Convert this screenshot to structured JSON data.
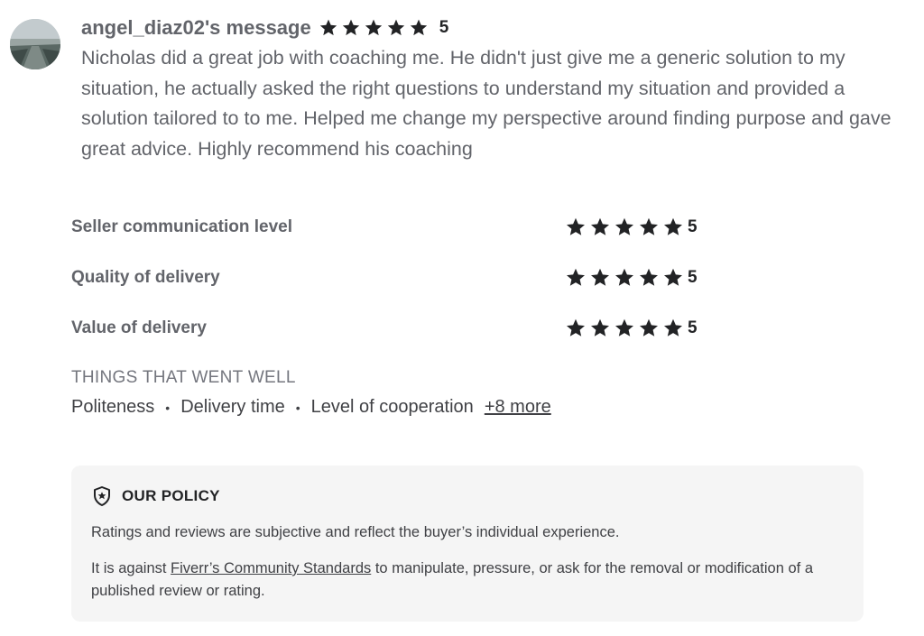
{
  "review": {
    "username_label": "angel_diaz02's message",
    "rating": "5",
    "star_count": 5,
    "message": "Nicholas did a great job with coaching me. He didn't just give me a generic solution to my situation, he actually asked the right questions to understand my situation and provided a solution tailored to to me. Helped me change my perspective around finding purpose and gave great advice. Highly recommend his coaching"
  },
  "breakdown": [
    {
      "label": "Seller communication level",
      "rating": "5"
    },
    {
      "label": "Quality of delivery",
      "rating": "5"
    },
    {
      "label": "Value of delivery",
      "rating": "5"
    }
  ],
  "went_well": {
    "title": "THINGS THAT WENT WELL",
    "items": [
      "Politeness",
      "Delivery time",
      "Level of cooperation"
    ],
    "separator": "•",
    "more_label": "+8 more"
  },
  "policy": {
    "title": "OUR POLICY",
    "paragraph1": "Ratings and reviews are subjective and reflect the buyer’s individual experience.",
    "paragraph2_before": "It is against ",
    "paragraph2_link": "Fiverr’s Community Standards",
    "paragraph2_after": " to manipulate, pressure, or ask for the removal or modification of a published review or rating."
  },
  "colors": {
    "star": "#222325",
    "text_muted": "#62646a",
    "policy_bg": "#f5f5f5"
  },
  "icons": {
    "star": "star-icon",
    "policy": "shield-star-icon"
  }
}
